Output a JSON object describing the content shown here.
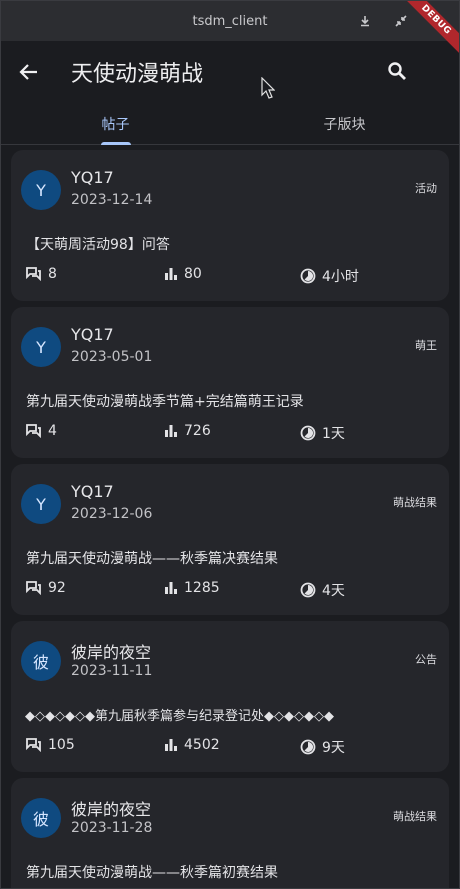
{
  "window": {
    "title": "tsdm_client"
  },
  "appbar": {
    "title": "天使动漫萌战",
    "debug_label": "DEBUG"
  },
  "tabs": [
    {
      "label": "帖子",
      "active": true
    },
    {
      "label": "子版块",
      "active": false
    }
  ],
  "posts": [
    {
      "avatar": "Y",
      "author": "YQ17",
      "date": "2023-12-14",
      "tag": "活动",
      "title": "【天萌周活动98】问答",
      "replies": "8",
      "views": "80",
      "time": "4小时"
    },
    {
      "avatar": "Y",
      "author": "YQ17",
      "date": "2023-05-01",
      "tag": "萌王",
      "title": "第九届天使动漫萌战季节篇+完结篇萌王记录",
      "replies": "4",
      "views": "726",
      "time": "1天"
    },
    {
      "avatar": "Y",
      "author": "YQ17",
      "date": "2023-12-06",
      "tag": "萌战结果",
      "title": "第九届天使动漫萌战——秋季篇决赛结果",
      "replies": "92",
      "views": "1285",
      "time": "4天"
    },
    {
      "avatar": "彼",
      "author": "彼岸的夜空",
      "date": "2023-11-11",
      "tag": "公告",
      "title": "◆◇◆◇◆◇◆第九届秋季篇参与纪录登记处◆◇◆◇◆◇◆",
      "replies": "105",
      "views": "4502",
      "time": "9天"
    },
    {
      "avatar": "彼",
      "author": "彼岸的夜空",
      "date": "2023-11-28",
      "tag": "萌战结果",
      "title": "第九届天使动漫萌战——秋季篇初赛结果",
      "replies": "",
      "views": "",
      "time": ""
    }
  ],
  "colors": {
    "accent": "#a8c7fa",
    "avatar_bg": "#0f4a80",
    "card_bg": "#25262b",
    "background": "#1b1c20"
  }
}
